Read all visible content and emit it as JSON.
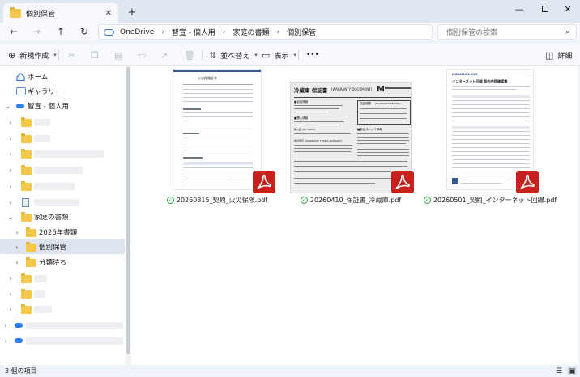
{
  "window": {
    "tab_title": "個別保管",
    "new_tab_label": "+",
    "minimize_label": "—",
    "close_label": "✕"
  },
  "address": {
    "crumbs": [
      "OneDrive",
      "智宣 - 個人用",
      "家庭の書類",
      "個別保管"
    ],
    "search_placeholder": "個別保管の検索"
  },
  "toolbar": {
    "new_label": "新規作成",
    "sort_label": "並べ替え",
    "view_label": "表示",
    "more_label": "•••",
    "details_label": "詳細"
  },
  "sidebar": {
    "home_label": "ホーム",
    "gallery_label": "ギャラリー",
    "onedrive_label": "智宣 - 個人用",
    "family_docs_label": "家庭の書類",
    "year_folder_label": "2026年書類",
    "current_folder_label": "個別保管",
    "unsorted_label": "分類待ち"
  },
  "files": [
    {
      "name": "20260315_契約_火災保険.pdf",
      "doc_title": "火災保険証券"
    },
    {
      "name": "20260410_保証書_冷蔵庫.pdf",
      "doc_title": "冷蔵庫 保証書",
      "doc_subtitle": "(WARRANTY DOCUMENT)",
      "right_box_label": "保証期間",
      "right_box_subtitle": "(WARRANTY PERIOD)",
      "terms_label": "保証規定 (WARRANTY TERMS SUMMARY)",
      "store_label": "購入店 (RETAILER)"
    },
    {
      "name": "20260501_契約_インターネット回線.pdf",
      "brand": "MADAMON.COM",
      "doc_title": "インターネット回線 契約内容確認書"
    }
  ],
  "status": {
    "item_count": "3 個の項目"
  },
  "colors": {
    "pdf_badge": "#c8201c",
    "folder": "#f3c84b",
    "accent": "#3a7bd5",
    "sync_ok": "#2ea043"
  }
}
